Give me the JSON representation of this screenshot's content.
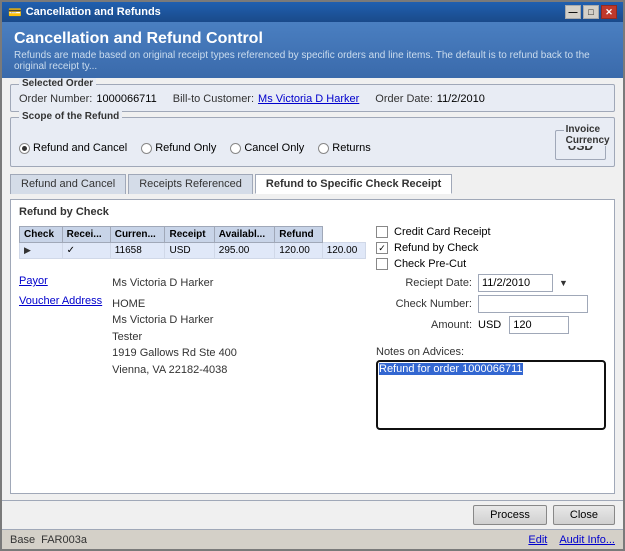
{
  "window": {
    "title": "Cancellation and Refunds",
    "icon": "💳"
  },
  "header": {
    "title": "Cancellation and Refund Control",
    "subtitle": "Refunds are made based on original receipt types referenced by specific orders and line items. The default is to refund back to the original receipt ty..."
  },
  "selected_order": {
    "label": "Selected Order",
    "order_number_label": "Order Number:",
    "order_number": "1000066711",
    "bill_to_label": "Bill-to Customer:",
    "bill_to": "Ms Victoria D Harker",
    "order_date_label": "Order Date:",
    "order_date": "11/2/2010"
  },
  "scope": {
    "label": "Scope of the Refund",
    "options": [
      {
        "id": "refund_cancel",
        "label": "Refund and Cancel",
        "selected": true
      },
      {
        "id": "refund_only",
        "label": "Refund Only",
        "selected": false
      },
      {
        "id": "cancel_only",
        "label": "Cancel Only",
        "selected": false
      },
      {
        "id": "returns",
        "label": "Returns",
        "selected": false
      }
    ],
    "invoice_currency_label": "Invoice Currency",
    "invoice_currency": "USD"
  },
  "tabs": [
    {
      "id": "refund_cancel",
      "label": "Refund and Cancel",
      "active": false
    },
    {
      "id": "receipts_referenced",
      "label": "Receipts Referenced",
      "active": false
    },
    {
      "id": "refund_check",
      "label": "Refund to Specific Check Receipt",
      "active": true
    }
  ],
  "tab_content_title": "Refund by Check",
  "table": {
    "headers": [
      "Check",
      "Recei...",
      "Curren...",
      "Receipt",
      "Availabl...",
      "Refund"
    ],
    "rows": [
      {
        "expand": "▶",
        "check": "✓",
        "receipt": "11658",
        "currency": "USD",
        "receipt_amt": "295.00",
        "available": "120.00",
        "refund": "120.00"
      }
    ]
  },
  "checkboxes": {
    "credit_card": {
      "label": "Credit Card Receipt",
      "checked": false
    },
    "refund_by_check": {
      "label": "Refund by Check",
      "checked": true
    },
    "check_pre_cut": {
      "label": "Check Pre-Cut",
      "checked": false
    }
  },
  "form_fields": {
    "receipt_date_label": "Reciept Date:",
    "receipt_date": "11/2/2010",
    "check_number_label": "Check Number:",
    "check_number": "",
    "amount_label": "Amount:",
    "amount_currency": "USD",
    "amount_value": "120"
  },
  "payor": {
    "link_label": "Payor",
    "value": "Ms Victoria D Harker"
  },
  "voucher": {
    "link_label": "Voucher Address",
    "lines": [
      "HOME",
      "Ms Victoria D Harker",
      "Tester",
      "1919 Gallows Rd Ste 400",
      "Vienna, VA 22182-4038"
    ]
  },
  "notes": {
    "label": "Notes on Advices:",
    "value": "Refund for order 1000066711",
    "selected_text": "Refund for order 1000066711"
  },
  "buttons": {
    "process": "Process",
    "close": "Close"
  },
  "status_bar": {
    "base": "Base",
    "base_value": "FAR003a",
    "edit": "Edit",
    "audit_info": "Audit Info..."
  }
}
